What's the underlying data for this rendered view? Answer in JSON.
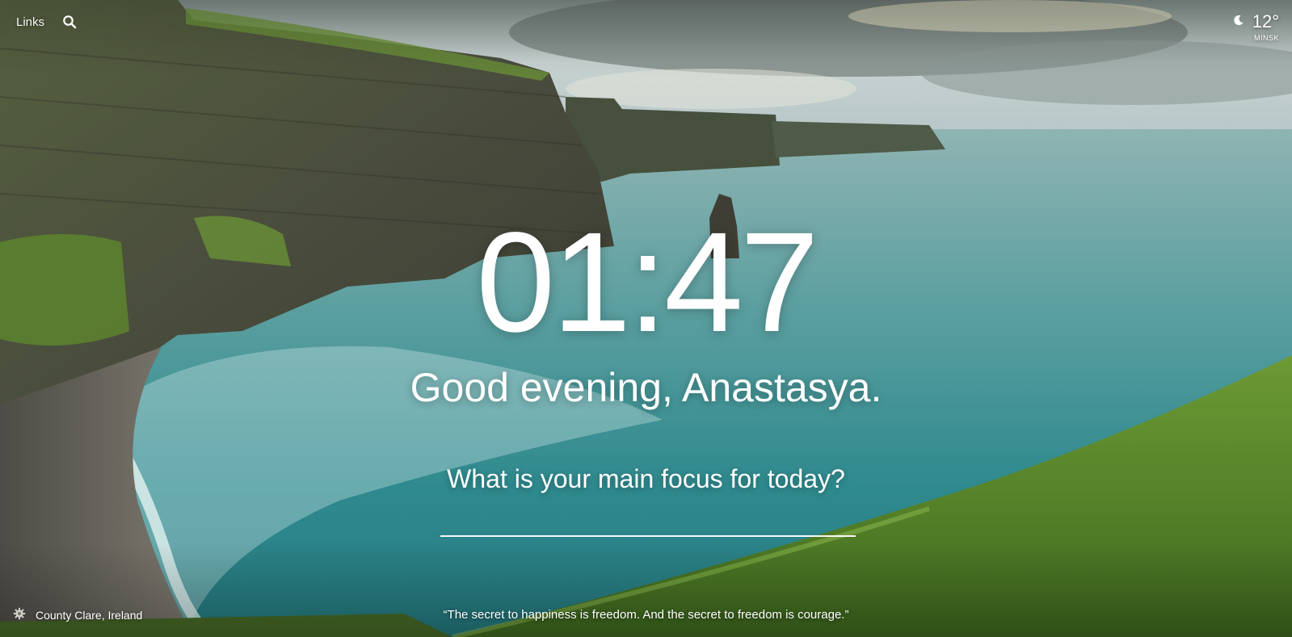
{
  "top_left": {
    "links_label": "Links",
    "search_icon": "search-icon"
  },
  "weather": {
    "icon": "moon-icon",
    "temperature": "12°",
    "city": "MINSK"
  },
  "clock": {
    "time": "01:47"
  },
  "greeting": {
    "text": "Good evening, Anastasya."
  },
  "focus": {
    "question": "What is your main focus for today?",
    "value": ""
  },
  "background_info": {
    "settings_icon": "gear-icon",
    "location": "County Clare, Ireland"
  },
  "quote": {
    "text": "“The secret to happiness is freedom. And the secret to freedom is courage.”"
  },
  "colors": {
    "sky": "#9fb3b8",
    "sea": "#3f8f93",
    "cliff": "#4b5a3e",
    "grass": "#5f8a2e",
    "text": "#ffffff"
  }
}
